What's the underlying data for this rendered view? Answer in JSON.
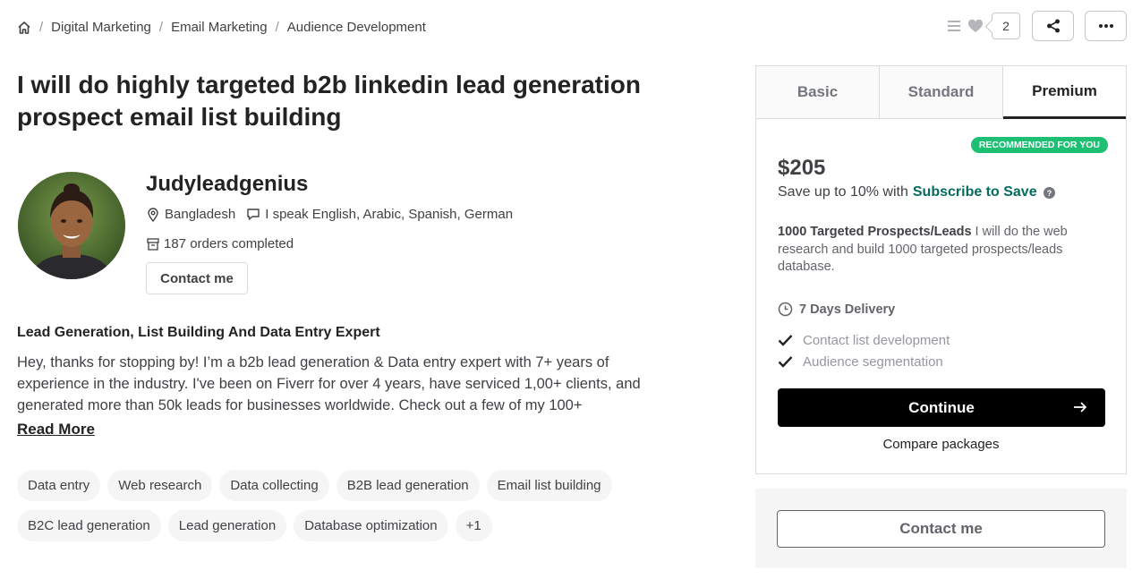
{
  "breadcrumb": {
    "home_icon": "home-icon",
    "items": [
      "Digital Marketing",
      "Email Marketing",
      "Audience Development"
    ]
  },
  "top_actions": {
    "list_icon": "list-icon",
    "like_icon": "heart-icon",
    "like_count": "2",
    "share_icon": "share-icon",
    "more_icon": "more-icon"
  },
  "gig": {
    "title": "I will do highly targeted b2b linkedin lead generation prospect email list building"
  },
  "seller": {
    "name": "Judyleadgenius",
    "country": "Bangladesh",
    "languages": "I speak English, Arabic, Spanish, German",
    "orders": "187 orders completed",
    "contact_label": "Contact me"
  },
  "about": {
    "heading": "Lead Generation, List Building And Data Entry Expert",
    "text": "Hey, thanks for stopping by! I’m a b2b lead generation & Data entry expert with 7+ years of experience in the industry. I've been on Fiverr for over 4 years, have serviced 1,00+ clients, and generated more than 50k leads for businesses worldwide. Check out a few of my 100+",
    "read_more": "Read More"
  },
  "tags": [
    "Data entry",
    "Web research",
    "Data collecting",
    "B2B lead generation",
    "Email list building",
    "B2C lead generation",
    "Lead generation",
    "Database optimization",
    "+1"
  ],
  "package": {
    "tabs": [
      "Basic",
      "Standard",
      "Premium"
    ],
    "active_tab": "Premium",
    "badge": "RECOMMENDED FOR YOU",
    "price": "$205",
    "save_prefix": "Save up to 10% with",
    "save_link": "Subscribe to Save",
    "desc_title": "1000 Targeted Prospects/Leads",
    "desc_text": " I will do the web research and build 1000 targeted prospects/leads database.",
    "delivery": "7 Days Delivery",
    "features": [
      "Contact list development",
      "Audience segmentation"
    ],
    "continue_label": "Continue",
    "compare_label": "Compare packages"
  },
  "contact_panel": {
    "label": "Contact me"
  },
  "colors": {
    "accent_green": "#1dbf73",
    "subscribe_green": "#046b5e",
    "text_dark": "#222325",
    "text_gray": "#62646a"
  }
}
